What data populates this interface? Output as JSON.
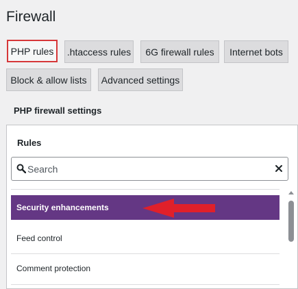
{
  "page": {
    "title": "Firewall"
  },
  "tabs": [
    {
      "label": "PHP rules",
      "active": true
    },
    {
      "label": ".htaccess rules",
      "active": false
    },
    {
      "label": "6G firewall rules",
      "active": false
    },
    {
      "label": "Internet bots",
      "active": false
    },
    {
      "label": "Block & allow lists",
      "active": false
    },
    {
      "label": "Advanced settings",
      "active": false
    }
  ],
  "section": {
    "heading": "PHP firewall settings"
  },
  "panel": {
    "rules_label": "Rules",
    "search": {
      "placeholder": "Search",
      "value": ""
    },
    "items": [
      {
        "label": "Security enhancements",
        "selected": true
      },
      {
        "label": "Feed control",
        "selected": false
      },
      {
        "label": "Comment protection",
        "selected": false
      }
    ]
  },
  "colors": {
    "accent_purple": "#643784",
    "highlight_red": "#d63638",
    "arrow_red": "#e0202a"
  },
  "icons": {
    "search": "search-icon",
    "clear": "close-icon",
    "arrow": "arrow-left-icon"
  }
}
